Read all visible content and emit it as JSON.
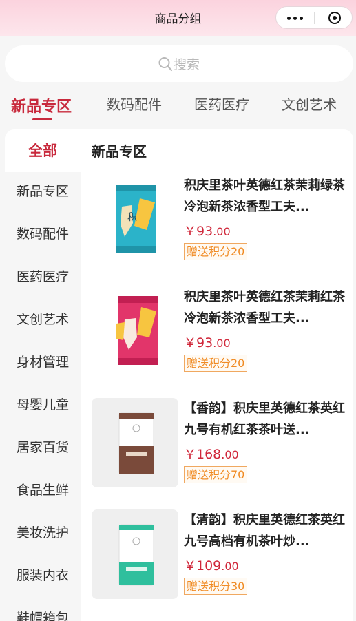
{
  "nav": {
    "title": "商品分组",
    "more_icon": "more-dots-icon",
    "close_icon": "target-circle-icon"
  },
  "search": {
    "placeholder": "搜索",
    "icon": "search-icon"
  },
  "tabs": [
    {
      "label": "新品专区",
      "active": true
    },
    {
      "label": "数码配件",
      "active": false
    },
    {
      "label": "医药医疗",
      "active": false
    },
    {
      "label": "文创艺术",
      "active": false
    }
  ],
  "sidebar": {
    "items": [
      {
        "label": "全部",
        "active": true
      },
      {
        "label": "新品专区"
      },
      {
        "label": "数码配件"
      },
      {
        "label": "医药医疗"
      },
      {
        "label": "文创艺术"
      },
      {
        "label": "身材管理"
      },
      {
        "label": "母婴儿童"
      },
      {
        "label": "居家百货"
      },
      {
        "label": "食品生鲜"
      },
      {
        "label": "美妆洗护"
      },
      {
        "label": "服装内衣"
      },
      {
        "label": "鞋帽箱包"
      }
    ]
  },
  "section": {
    "title": "新品专区"
  },
  "products": [
    {
      "title": "积庆里茶叶英德红茶茉莉绿茶冷泡新茶浓香型工夫...",
      "currency": "￥",
      "price_int": "93",
      "price_dec": ".00",
      "badge": "赠送积分20",
      "image_color": "#2bb3c9"
    },
    {
      "title": "积庆里茶叶英德红茶茉莉红茶冷泡新茶浓香型工夫...",
      "currency": "￥",
      "price_int": "93",
      "price_dec": ".00",
      "badge": "赠送积分20",
      "image_color": "#e2356a"
    },
    {
      "title": "【香韵】积庆里英德红茶英红九号有机红茶茶叶送...",
      "currency": "￥",
      "price_int": "168",
      "price_dec": ".00",
      "badge": "赠送积分70",
      "image_color": "#7a4a3a"
    },
    {
      "title": "【清韵】积庆里英德红茶英红九号高档有机茶叶炒...",
      "currency": "￥",
      "price_int": "109",
      "price_dec": ".00",
      "badge": "赠送积分30",
      "image_color": "#2fbf9d"
    }
  ]
}
